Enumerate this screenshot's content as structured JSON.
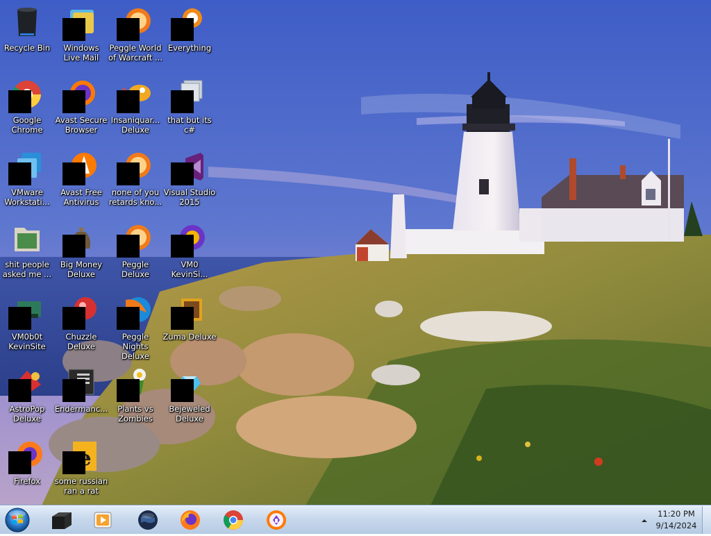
{
  "desktop": {
    "icons": [
      {
        "label": "Recycle Bin",
        "icon": "recycle-bin-icon",
        "redacted": false
      },
      {
        "label": "Windows Live Mail",
        "icon": "mail-icon",
        "redacted": true
      },
      {
        "label": "Peggle World of Warcraft ...",
        "icon": "peggle-icon",
        "redacted": true
      },
      {
        "label": "Everything",
        "icon": "search-app-icon",
        "redacted": true
      },
      {
        "label": "Google Chrome",
        "icon": "chrome-icon",
        "redacted": true
      },
      {
        "label": "Avast Secure Browser",
        "icon": "avast-browser-icon",
        "redacted": true
      },
      {
        "label": "Insaniquar... Deluxe",
        "icon": "fish-icon",
        "redacted": true
      },
      {
        "label": "that but its c#",
        "icon": "stack-icon",
        "redacted": true
      },
      {
        "label": "VMware Workstati...",
        "icon": "vmware-icon",
        "redacted": true
      },
      {
        "label": "Avast Free Antivirus",
        "icon": "avast-icon",
        "redacted": true
      },
      {
        "label": "none of you retards kno...",
        "icon": "peggle-icon",
        "redacted": true
      },
      {
        "label": "Visual Studio 2015",
        "icon": "visual-studio-icon",
        "redacted": true
      },
      {
        "label": "shit people asked me ...",
        "icon": "folder-icon",
        "redacted": false
      },
      {
        "label": "Big Money Deluxe",
        "icon": "money-bag-icon",
        "redacted": true
      },
      {
        "label": "Peggle Deluxe",
        "icon": "peggle-icon",
        "redacted": true
      },
      {
        "label": "VM0 KevinSi...",
        "icon": "vm-icon",
        "redacted": true
      },
      {
        "label": "VM0b0t KevinSite",
        "icon": "vm-bot-icon",
        "redacted": true
      },
      {
        "label": "Chuzzle Deluxe",
        "icon": "chuzzle-icon",
        "redacted": true
      },
      {
        "label": "Peggle Nights Deluxe",
        "icon": "peggle-nights-icon",
        "redacted": true
      },
      {
        "label": "Zuma Deluxe",
        "icon": "zuma-icon",
        "redacted": true
      },
      {
        "label": "AstroPop Deluxe",
        "icon": "astropop-icon",
        "redacted": true
      },
      {
        "label": "Endermanc...",
        "icon": "terminal-icon",
        "redacted": true
      },
      {
        "label": "Plants vs Zombies",
        "icon": "plant-icon",
        "redacted": true
      },
      {
        "label": "Bejeweled Deluxe",
        "icon": "gem-icon",
        "redacted": true
      },
      {
        "label": "Firefox",
        "icon": "firefox-icon",
        "redacted": true
      },
      {
        "label": "some russian ran a rat",
        "icon": "document-icon",
        "redacted": true
      }
    ]
  },
  "taskbar": {
    "items": [
      {
        "icon": "start-orb-icon"
      },
      {
        "icon": "terminal-app-icon"
      },
      {
        "icon": "media-player-icon"
      },
      {
        "icon": "globe-icon"
      },
      {
        "icon": "firefox-icon"
      },
      {
        "icon": "chrome-icon"
      },
      {
        "icon": "avast-browser-icon"
      }
    ],
    "clock": {
      "time": "11:20 PM",
      "date": "9/14/2024"
    }
  }
}
